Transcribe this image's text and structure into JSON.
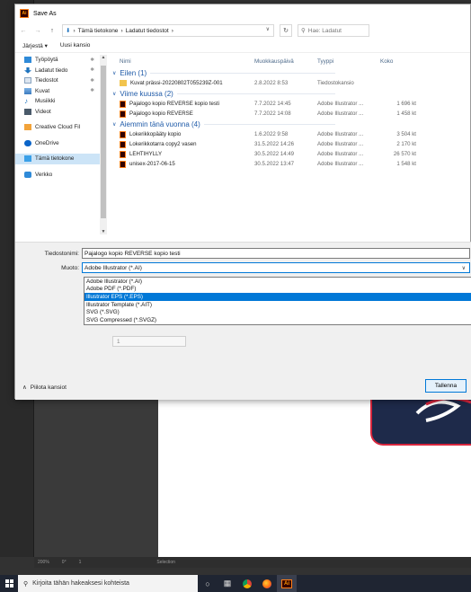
{
  "dialog": {
    "title": "Save As",
    "app_icon_text": "Ai"
  },
  "nav": {
    "back": "←",
    "forward": "→",
    "up": "↑",
    "breadcrumb": [
      "Tämä tietokone",
      "Ladatut tiedostot"
    ],
    "search_placeholder": "Hae: Ladatut"
  },
  "toolbar": {
    "organize": "Järjestä ▾",
    "new_folder": "Uusi kansio"
  },
  "sidebar": {
    "items": [
      {
        "label": "Työpöytä",
        "icon": "desktop-icon",
        "pinned": true
      },
      {
        "label": "Ladatut tiedo",
        "icon": "download-icon",
        "pinned": true
      },
      {
        "label": "Tiedostot",
        "icon": "documents-icon",
        "pinned": true
      },
      {
        "label": "Kuvat",
        "icon": "pictures-icon",
        "pinned": true
      },
      {
        "label": "Musiikki",
        "icon": "music-icon",
        "pinned": false
      },
      {
        "label": "Videot",
        "icon": "videos-icon",
        "pinned": false
      },
      {
        "label": "Creative Cloud Fil",
        "icon": "creative-cloud-icon",
        "pinned": false
      },
      {
        "label": "OneDrive",
        "icon": "onedrive-icon",
        "pinned": false
      },
      {
        "label": "Tämä tietokone",
        "icon": "computer-icon",
        "pinned": false
      },
      {
        "label": "Verkko",
        "icon": "network-icon",
        "pinned": false
      }
    ]
  },
  "columns": {
    "name": "Nimi",
    "date": "Muokkauspäivä",
    "type": "Tyyppi",
    "size": "Koko"
  },
  "groups": [
    {
      "header": "Eilen (1)",
      "files": [
        {
          "name": "Kuvat prässi-20220802T055239Z-001",
          "date": "2.8.2022 8:53",
          "type": "Tiedostokansio",
          "size": "",
          "kind": "folder"
        }
      ]
    },
    {
      "header": "Viime kuussa (2)",
      "files": [
        {
          "name": "Pajalogo kopio REVERSE kopio testi",
          "date": "7.7.2022 14:45",
          "type": "Adobe Illustrator ...",
          "size": "1 696 kt",
          "kind": "ai"
        },
        {
          "name": "Pajalogo kopio REVERSE",
          "date": "7.7.2022 14:08",
          "type": "Adobe Illustrator ...",
          "size": "1 458 kt",
          "kind": "ai"
        }
      ]
    },
    {
      "header": "Aiemmin tänä vuonna (4)",
      "files": [
        {
          "name": "Lokerikkopääty kopio",
          "date": "1.6.2022 9:58",
          "type": "Adobe Illustrator ...",
          "size": "3 504 kt",
          "kind": "ai"
        },
        {
          "name": "Lokerikkotarra copy2 vasen",
          "date": "31.5.2022 14:26",
          "type": "Adobe Illustrator ...",
          "size": "2 170 kt",
          "kind": "ai"
        },
        {
          "name": "LEHTIHYLLY",
          "date": "30.5.2022 14:49",
          "type": "Adobe Illustrator ...",
          "size": "26 570 kt",
          "kind": "ai"
        },
        {
          "name": "unisex-2017-06-15",
          "date": "30.5.2022 13:47",
          "type": "Adobe Illustrator ...",
          "size": "1 548 kt",
          "kind": "ai"
        }
      ]
    }
  ],
  "form": {
    "filename_label": "Tiedostonimi:",
    "filename_value": "Pajalogo kopio REVERSE kopio testi",
    "format_label": "Muoto:",
    "format_value": "Adobe Illustrator (*.AI)",
    "format_options": [
      {
        "label": "Adobe Illustrator (*.AI)",
        "selected": false
      },
      {
        "label": "Adobe PDF (*.PDF)",
        "selected": false
      },
      {
        "label": "Illustrator EPS (*.EPS)",
        "selected": true
      },
      {
        "label": "Illustrator Template (*.AIT)",
        "selected": false
      },
      {
        "label": "SVG (*.SVG)",
        "selected": false
      },
      {
        "label": "SVG Compressed (*.SVGZ)",
        "selected": false
      }
    ],
    "artboards_value": "1",
    "hide_folders": "Piilota kansiot",
    "save_button": "Tallenna"
  },
  "status_bar": {
    "zoom": "200%",
    "rotation": "0°",
    "artboard": "1",
    "tool": "Selection"
  },
  "taskbar": {
    "search_placeholder": "Kirjoita tähän hakeaksesi kohteista",
    "ai_label": "Ai"
  },
  "colors": {
    "accent": "#0078d7",
    "group_header": "#1e5aa8",
    "selected_nav": "#cce4f7",
    "ai_brand_bg": "#330000",
    "ai_brand_fg": "#ff9a00"
  }
}
